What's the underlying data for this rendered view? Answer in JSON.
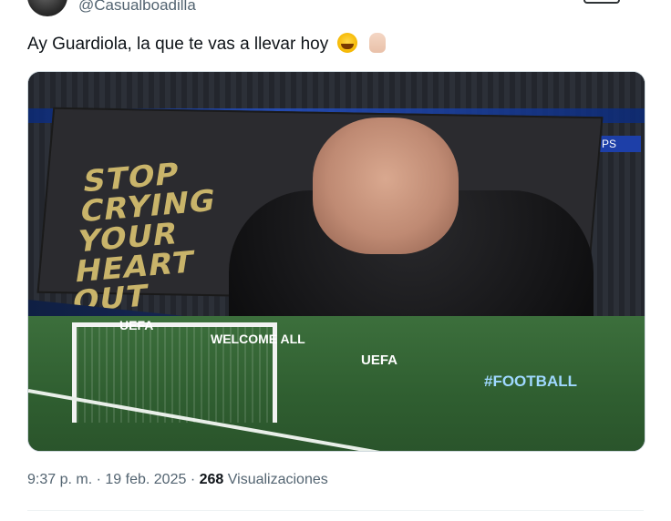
{
  "user": {
    "handle": "@Casualboadilla"
  },
  "tweet": {
    "text": "Ay Guardiola, la que te vas a llevar hoy",
    "emojis": [
      "rolling-on-floor-laughing",
      "raised-finger"
    ]
  },
  "media": {
    "banner_lines": [
      "STOP",
      "CRYING",
      "YOUR",
      "HEART",
      "OUT"
    ],
    "ad_boards": [
      "UEFA",
      "WELCOME ALL",
      "UEFA",
      "#FOOTBALL"
    ],
    "sponsor": "PS"
  },
  "meta": {
    "time": "9:37 p. m.",
    "date": "19 feb. 2025",
    "views_count": "268",
    "views_label": "Visualizaciones"
  }
}
